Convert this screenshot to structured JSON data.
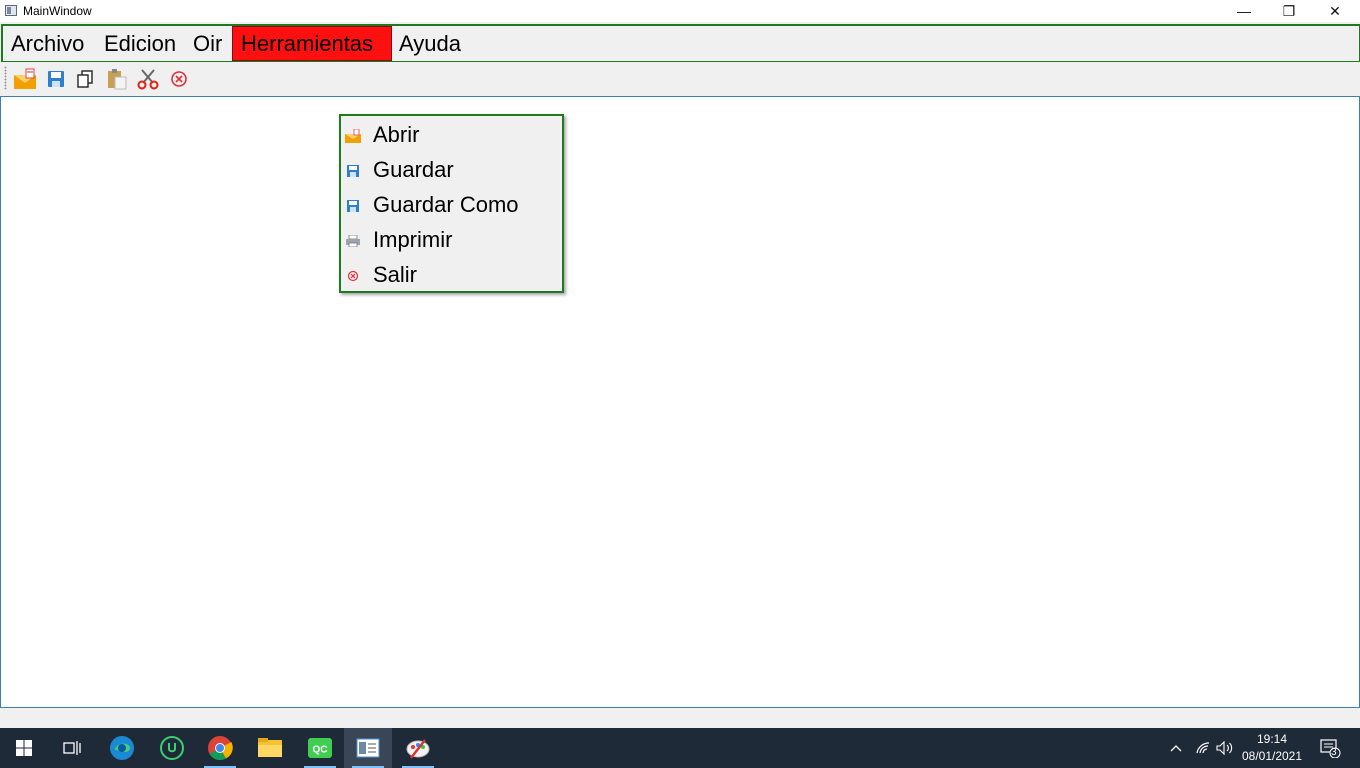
{
  "window": {
    "title": "MainWindow",
    "controls": {
      "minimize": "—",
      "restore": "❐",
      "close": "✕"
    }
  },
  "menubar": {
    "items": [
      {
        "label": "Archivo",
        "active": false
      },
      {
        "label": "Edicion",
        "active": false
      },
      {
        "label": "Oir",
        "active": false
      },
      {
        "label": "Herramientas",
        "active": true
      },
      {
        "label": "Ayuda",
        "active": false
      }
    ],
    "active_color": "#ff1010",
    "border_color": "#1f7a1f"
  },
  "toolbar": {
    "buttons": [
      {
        "icon": "open-envelope-icon"
      },
      {
        "icon": "save-icon"
      },
      {
        "icon": "copy-icon"
      },
      {
        "icon": "paste-icon"
      },
      {
        "icon": "cut-icon"
      },
      {
        "icon": "exit-icon"
      }
    ]
  },
  "dropdown": {
    "items": [
      {
        "label": "Abrir",
        "icon": "open-envelope-icon"
      },
      {
        "label": "Guardar",
        "icon": "save-icon"
      },
      {
        "label": "Guardar Como",
        "icon": "save-icon"
      },
      {
        "label": "Imprimir",
        "icon": "printer-icon"
      },
      {
        "label": "Salir",
        "icon": "exit-icon"
      }
    ]
  },
  "taskbar": {
    "apps": [
      {
        "icon": "windows-start-icon"
      },
      {
        "icon": "task-view-icon"
      },
      {
        "icon": "edge-icon"
      },
      {
        "icon": "upwork-icon"
      },
      {
        "icon": "chrome-icon"
      },
      {
        "icon": "file-explorer-icon"
      },
      {
        "icon": "qt-creator-icon"
      },
      {
        "icon": "main-window-app-icon"
      },
      {
        "icon": "paint-icon"
      }
    ],
    "clock": {
      "time": "19:14",
      "date": "08/01/2021"
    },
    "notifications_count": "3"
  }
}
